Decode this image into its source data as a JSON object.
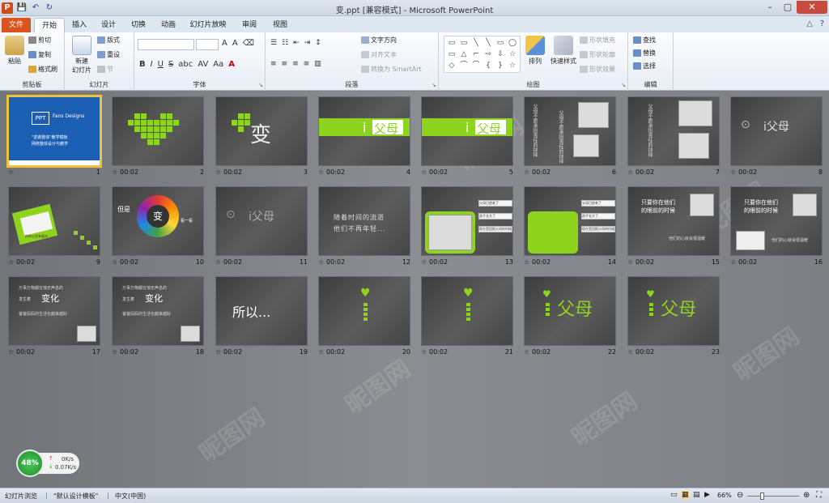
{
  "titlebar": {
    "title": "变.ppt [兼容模式] - Microsoft PowerPoint",
    "qat_save": "💾",
    "qat_undo": "↶",
    "qat_redo": "↻",
    "min": "–",
    "max": "▢",
    "close": "✕"
  },
  "tabs": [
    "文件",
    "开始",
    "插入",
    "设计",
    "切换",
    "动画",
    "幻灯片放映",
    "审阅",
    "视图"
  ],
  "ribbon": {
    "clipboard": {
      "label": "剪贴板",
      "paste": "粘贴",
      "cut": "剪切",
      "copy": "复制",
      "format_painter": "格式刷"
    },
    "slides": {
      "label": "幻灯片",
      "new_slide_1": "新建",
      "new_slide_2": "幻灯片",
      "layout": "版式",
      "reset": "重设",
      "section": "节"
    },
    "font": {
      "label": "字体",
      "bold": "B",
      "italic": "I",
      "underline": "U",
      "strike": "S",
      "shadow": "abc",
      "spacing": "AV",
      "case": "Aa",
      "color": "A",
      "grow": "A",
      "shrink": "A"
    },
    "paragraph": {
      "label": "段落",
      "text_direction": "文字方向",
      "align_text": "对齐文本",
      "smartart": "转换为 SmartArt"
    },
    "drawing": {
      "label": "绘图",
      "arrange": "排列",
      "quick_styles": "快速样式",
      "fill": "形状填充",
      "outline": "形状轮廓",
      "effects": "形状效果"
    },
    "editing": {
      "label": "编辑",
      "find": "查找",
      "replace": "替换",
      "select": "选择"
    }
  },
  "slides": [
    {
      "num": "1",
      "duration": "",
      "title": "PPT",
      "sub": "Fans Designs",
      "line1": "\"逆袭整体\"教学模板",
      "line2": "网络整体设计与教学"
    },
    {
      "num": "2",
      "duration": "00:02"
    },
    {
      "num": "3",
      "duration": "00:02",
      "text": "变"
    },
    {
      "num": "4",
      "duration": "00:02",
      "text": "父母",
      "prefix": "i"
    },
    {
      "num": "5",
      "duration": "00:02",
      "text": "父母",
      "prefix": "i"
    },
    {
      "num": "6",
      "duration": "00:02",
      "text": "父母不愿承担责任的抉择"
    },
    {
      "num": "7",
      "duration": "00:02",
      "text": "父母不愿承担责任的抉择"
    },
    {
      "num": "8",
      "duration": "00:02",
      "text": "i父母"
    },
    {
      "num": "9",
      "duration": "00:02",
      "text": "你的心里有爱吗"
    },
    {
      "num": "10",
      "duration": "00:02",
      "text": "变",
      "left": "但是",
      "right": "看一看"
    },
    {
      "num": "11",
      "duration": "00:02",
      "text": "i父母"
    },
    {
      "num": "12",
      "duration": "00:02",
      "line1": "随着时间的流逝",
      "line2": "他们不再年轻..."
    },
    {
      "num": "13",
      "duration": "00:02",
      "b1": "父母已经老了",
      "b2": "孩子长大了",
      "b3": "现在是回报父母的时候"
    },
    {
      "num": "14",
      "duration": "00:02",
      "b1": "父母已经老了",
      "b2": "孩子长大了",
      "b3": "现在是回报父母的时候"
    },
    {
      "num": "15",
      "duration": "00:02",
      "line1": "只要你在他们",
      "line2": "的眼前的时候",
      "line3": "他们的心就会很温暖"
    },
    {
      "num": "16",
      "duration": "00:02",
      "line1": "只要你在他们",
      "line2": "的眼前的时候",
      "line3": "他们的心就会很温暖"
    },
    {
      "num": "17",
      "duration": "00:02",
      "line1": "万事万物都在悄无声息的",
      "line2": "发生着",
      "big": "变化",
      "line3": "爸爸妈妈的生活也越来越好"
    },
    {
      "num": "18",
      "duration": "00:02",
      "line1": "万事万物都在悄无声息的",
      "line2": "发生着",
      "big": "变化",
      "line3": "爸爸妈妈的生活也越来越好"
    },
    {
      "num": "19",
      "duration": "00:02",
      "text": "所以..."
    },
    {
      "num": "20",
      "duration": "00:02"
    },
    {
      "num": "21",
      "duration": "00:02"
    },
    {
      "num": "22",
      "duration": "00:02",
      "text": "父母"
    },
    {
      "num": "23",
      "duration": "00:02",
      "text": "父母"
    }
  ],
  "perf": {
    "percent": "48%",
    "up": "0K/s",
    "down": "0.07K/s"
  },
  "status": {
    "view": "幻灯片浏览",
    "theme": "\"默认设计模板\"",
    "language": "中文(中国)",
    "zoom": "66%"
  },
  "watermark": "昵图网"
}
